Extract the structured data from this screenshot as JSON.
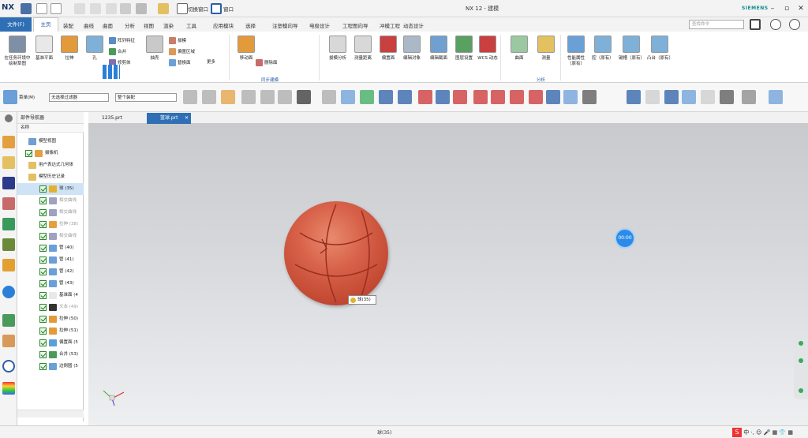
{
  "app": {
    "logo": "NX",
    "title": "NX 12 - 建模",
    "brand": "SIEMENS",
    "quick_access": [
      "保存",
      "撤消",
      "重做",
      "剪切",
      "复制",
      "粘贴",
      "重复命令",
      "切换窗口",
      "窗口"
    ],
    "switch_window_label": "切换窗口",
    "window_label": "窗口"
  },
  "menu": {
    "file": "文件(F)",
    "home": "主页",
    "items": [
      "装配",
      "曲线",
      "曲面",
      "分析",
      "视图",
      "渲染",
      "工具",
      "应用模块",
      "选择",
      "注塑模向导",
      "电极设计",
      "工程图向导",
      "冲模工程",
      "动态设计"
    ],
    "search_placeholder": "查找命令"
  },
  "ribbon": {
    "big_buttons": [
      {
        "label": "在任务环境中绘制草图",
        "color": "#7f8fa6"
      },
      {
        "label": "基准平面",
        "color": "#e8e8e8"
      },
      {
        "label": "拉伸",
        "color": "#e39a3b"
      },
      {
        "label": "孔",
        "color": "#7fb0d8"
      },
      {
        "label": "抽壳",
        "color": "#c9c9c9"
      },
      {
        "label": "更多",
        "color": "#a0a0a0"
      }
    ],
    "small_buttons": [
      {
        "label": "阵列特征",
        "color": "#5a8bc2"
      },
      {
        "label": "合并",
        "color": "#4a9a5c"
      },
      {
        "label": "修剪体",
        "color": "#7f6fb0"
      },
      {
        "label": "拔模",
        "color": "#c97d6b"
      },
      {
        "label": "偏置区域",
        "color": "#d89a5a"
      },
      {
        "label": "替换面",
        "color": "#6a9fd8"
      },
      {
        "label": "删除面",
        "color": "#c86a6a"
      }
    ],
    "more_label": "更多",
    "sync_group_label": "同步建模",
    "analysis_group_label": "分析",
    "right_buttons": [
      {
        "label": "移动面",
        "color": "#e39a3b"
      },
      {
        "label": "拔模分析",
        "color": "#d8d8d8"
      },
      {
        "label": "测量距离",
        "color": "#d8d8d8"
      },
      {
        "label": "偏置面",
        "color": "#c94040"
      },
      {
        "label": "编辑对象",
        "color": "#aab8c8"
      },
      {
        "label": "编辑截面",
        "color": "#6fa0d0"
      },
      {
        "label": "图层设置",
        "color": "#5aa060"
      },
      {
        "label": "WCS 动态",
        "color": "#c94040"
      },
      {
        "label": "曲面",
        "color": "#9ac8a0"
      },
      {
        "label": "测量",
        "color": "#e3c060"
      },
      {
        "label": "性能属性（原有）",
        "color": "#6a9fd8"
      },
      {
        "label": "腔（原有）",
        "color": "#7fb0d8"
      },
      {
        "label": "键槽（原有）",
        "color": "#7fb0d8"
      },
      {
        "label": "凸台（原有）",
        "color": "#7fb0d8"
      }
    ]
  },
  "toolbar2": {
    "menu_label": "菜单(M)",
    "filter1": "无选择过滤器",
    "filter2": "整个装配"
  },
  "tabs": [
    {
      "label": "1235.prt",
      "active": false
    },
    {
      "label": "篮球.prt",
      "active": true
    }
  ],
  "navigator": {
    "title": "部件导航器",
    "column": "名称",
    "rows": [
      {
        "label": "模型视图",
        "indent": 1,
        "check": false,
        "color": "#6fa0d0",
        "greyed": false
      },
      {
        "label": "摄像机",
        "indent": 1,
        "check": true,
        "color": "#e3a040",
        "greyed": false
      },
      {
        "label": "用户表达式几何体",
        "indent": 1,
        "check": false,
        "color": "#e3c060",
        "greyed": false
      },
      {
        "label": "模型历史记录",
        "indent": 1,
        "check": false,
        "color": "#e3c060",
        "greyed": false
      },
      {
        "label": "球 (35)",
        "indent": 2,
        "check": true,
        "color": "#e3b030",
        "greyed": false,
        "selected": true
      },
      {
        "label": "相交曲线",
        "indent": 2,
        "check": true,
        "color": "#a0a0c0",
        "greyed": true
      },
      {
        "label": "相交曲线",
        "indent": 2,
        "check": true,
        "color": "#a0a0c0",
        "greyed": true
      },
      {
        "label": "拉伸 (38)",
        "indent": 2,
        "check": true,
        "color": "#e3a040",
        "greyed": true
      },
      {
        "label": "相交曲线",
        "indent": 2,
        "check": true,
        "color": "#a0a0c0",
        "greyed": true
      },
      {
        "label": "管 (40)",
        "indent": 2,
        "check": true,
        "color": "#6a9fd8",
        "greyed": false
      },
      {
        "label": "管 (41)",
        "indent": 2,
        "check": true,
        "color": "#6a9fd8",
        "greyed": false
      },
      {
        "label": "管 (42)",
        "indent": 2,
        "check": true,
        "color": "#6a9fd8",
        "greyed": false
      },
      {
        "label": "管 (43)",
        "indent": 2,
        "check": true,
        "color": "#6a9fd8",
        "greyed": false
      },
      {
        "label": "基准面 (4",
        "indent": 2,
        "check": true,
        "color": "#e8e8e8",
        "greyed": false
      },
      {
        "label": "文本 (49)",
        "indent": 2,
        "check": true,
        "color": "#333333",
        "greyed": true
      },
      {
        "label": "拉伸 (50)",
        "indent": 2,
        "check": true,
        "color": "#e39a3b",
        "greyed": false
      },
      {
        "label": "拉伸 (51)",
        "indent": 2,
        "check": true,
        "color": "#e39a3b",
        "greyed": false
      },
      {
        "label": "偏置面 (5",
        "indent": 2,
        "check": true,
        "color": "#5aa0d8",
        "greyed": false
      },
      {
        "label": "合并 (53)",
        "indent": 2,
        "check": true,
        "color": "#4a9a5c",
        "greyed": false
      },
      {
        "label": "边倒圆 (5",
        "indent": 2,
        "check": true,
        "color": "#6a9fd8",
        "greyed": false
      }
    ]
  },
  "viewport": {
    "tooltip": "球(35)",
    "timer": "00:00"
  },
  "status": {
    "text": "球(35)",
    "ime": "中 ·, ☺ 🎤 ▦ 👕 ▦"
  },
  "colors": {
    "accent": "#2f6fb5",
    "ball": "#d8634a"
  }
}
